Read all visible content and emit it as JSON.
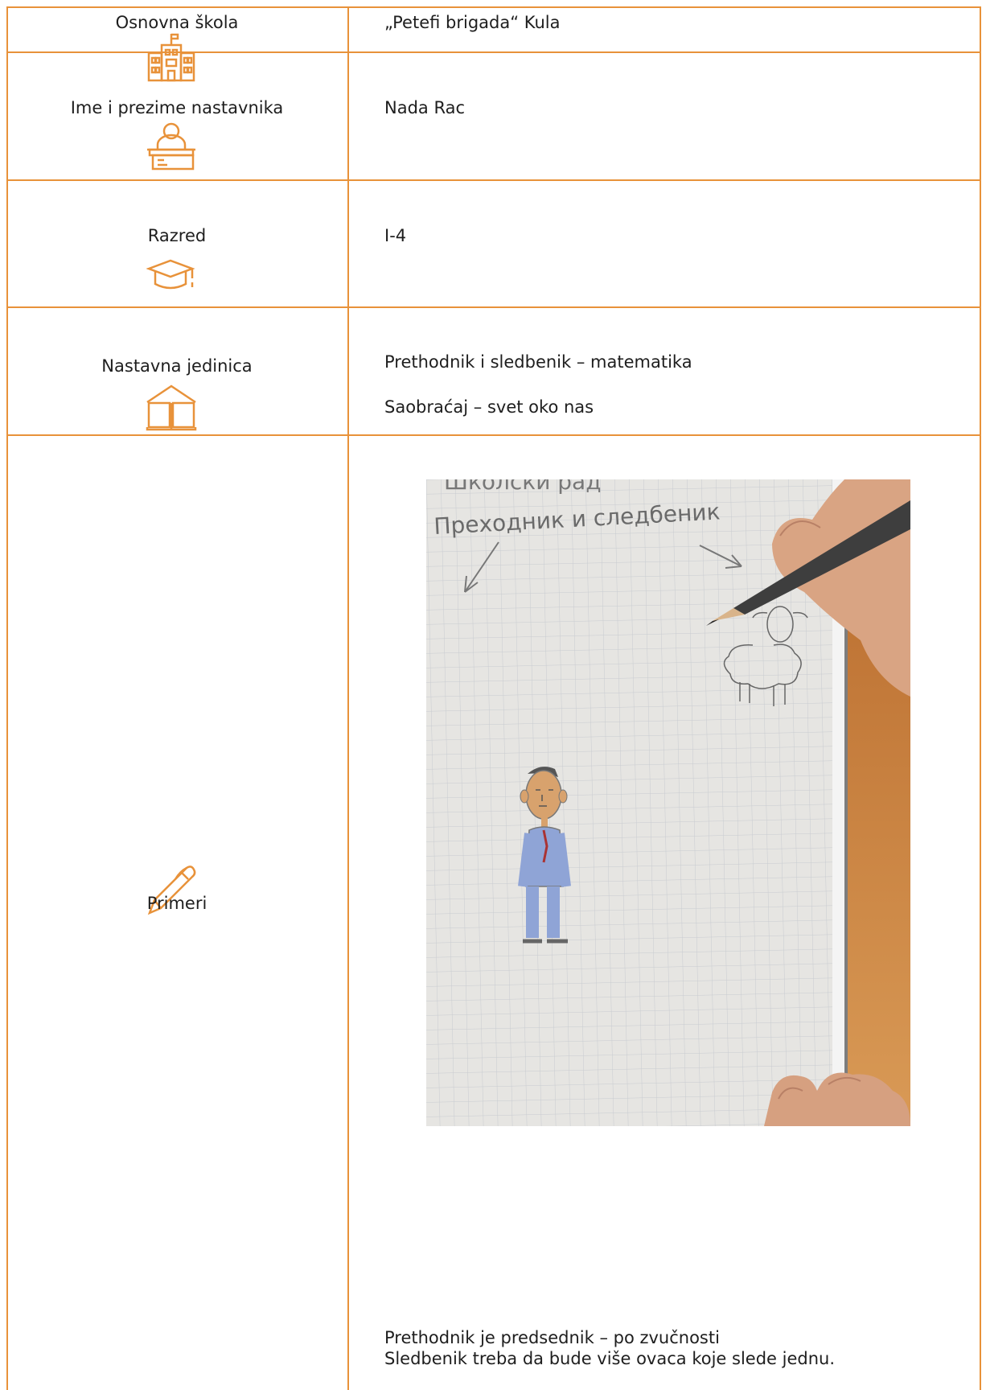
{
  "rows": {
    "school": {
      "label": "Osnovna škola",
      "value": "„Petefi brigada“ Kula"
    },
    "teacher": {
      "label": "Ime i prezime nastavnika",
      "value": "Nada Rac"
    },
    "grade": {
      "label": "Razred",
      "value": "I-4"
    },
    "unit": {
      "label": "Nastavna jedinica",
      "values": [
        "Prethodnik i sledbenik – matematika",
        "Saobraćaj – svet oko nas"
      ]
    },
    "examples": {
      "label": "Primeri",
      "photo": {
        "notebook_text": [
          "Школски рад",
          "Преходник и следбеник"
        ]
      },
      "caption": [
        "Prethodnik je predsednik – po zvučnosti",
        "Sledbenik treba da bude više ovaca koje slede jednu."
      ]
    }
  },
  "icons": {
    "school": "school-building-icon",
    "teacher": "teacher-desk-icon",
    "grade": "graduation-cap-icon",
    "unit": "open-book-icon",
    "examples": "pen-icon"
  },
  "colors": {
    "accent": "#e8923a",
    "text": "#1e1e1e"
  }
}
